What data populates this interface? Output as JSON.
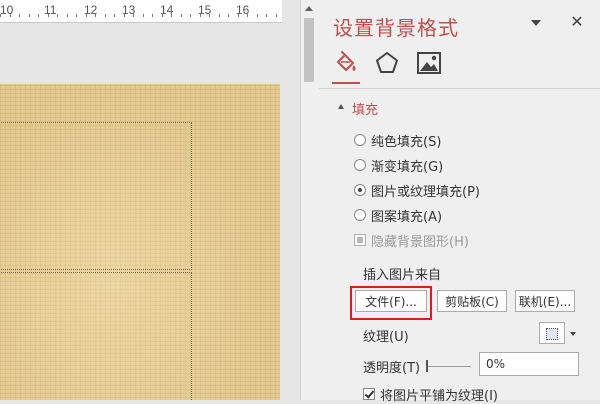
{
  "ruler": {
    "labels": [
      "10",
      "11",
      "12",
      "13",
      "14",
      "15",
      "16"
    ]
  },
  "pane": {
    "title": "设置背景格式",
    "close_glyph": "✕",
    "tabs": [
      {
        "icon": "paint-bucket-icon",
        "selected": true
      },
      {
        "icon": "pentagon-icon",
        "selected": false
      },
      {
        "icon": "picture-icon",
        "selected": false
      }
    ],
    "section_label": "填充",
    "options": {
      "solid": "纯色填充(S)",
      "gradient": "渐变填充(G)",
      "picture": "图片或纹理填充(P)",
      "pattern": "图案填充(A)",
      "selected": "picture"
    },
    "hide_bg": "隐藏背景图形(H)",
    "insert_from": "插入图片来自",
    "buttons": {
      "file": "文件(F)...",
      "clipboard": "剪贴板(C)",
      "online": "联机(E)..."
    },
    "texture_label": "纹理(U)",
    "transparency_label": "透明度(T)",
    "transparency_value": "0%",
    "tile_label": "将图片平铺为纹理(I)"
  },
  "colors": {
    "accent": "#c0504d",
    "highlight": "#d81e1e",
    "slide": "#e2c98f"
  }
}
